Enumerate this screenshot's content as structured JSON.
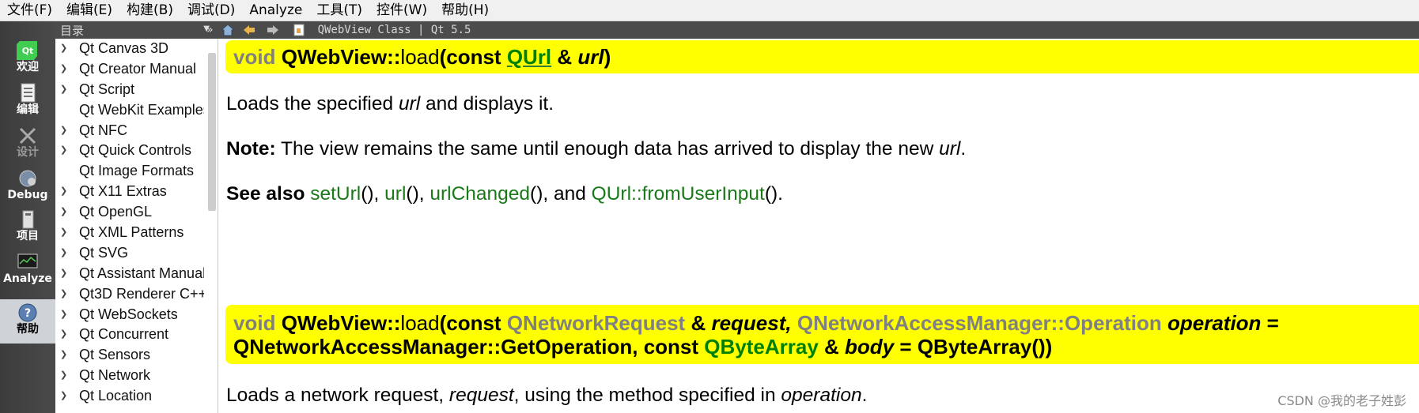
{
  "menubar": {
    "items": [
      "文件(F)",
      "编辑(E)",
      "构建(B)",
      "调试(D)",
      "Analyze",
      "工具(T)",
      "控件(W)",
      "帮助(H)"
    ]
  },
  "modes": [
    {
      "label": "欢迎",
      "icon": "qt-logo-icon"
    },
    {
      "label": "编辑",
      "icon": "edit-document-icon"
    },
    {
      "label": "设计",
      "icon": "design-tools-icon"
    },
    {
      "label": "Debug",
      "icon": "debug-bug-icon"
    },
    {
      "label": "项目",
      "icon": "project-icon"
    },
    {
      "label": "Analyze",
      "icon": "analyze-monitor-icon"
    },
    {
      "label": "帮助",
      "icon": "help-icon"
    }
  ],
  "sidebar": {
    "header": "目录",
    "items": [
      {
        "label": "Qt Canvas 3D",
        "expandable": true
      },
      {
        "label": "Qt Creator Manual",
        "expandable": true
      },
      {
        "label": "Qt Script",
        "expandable": true
      },
      {
        "label": "Qt WebKit Examples",
        "expandable": false
      },
      {
        "label": "Qt NFC",
        "expandable": true
      },
      {
        "label": "Qt Quick Controls",
        "expandable": true
      },
      {
        "label": "Qt Image Formats",
        "expandable": false
      },
      {
        "label": "Qt X11 Extras",
        "expandable": true
      },
      {
        "label": "Qt OpenGL",
        "expandable": true
      },
      {
        "label": "Qt XML Patterns",
        "expandable": true
      },
      {
        "label": "Qt SVG",
        "expandable": true
      },
      {
        "label": "Qt Assistant Manual",
        "expandable": true
      },
      {
        "label": "Qt3D Renderer C++",
        "expandable": true
      },
      {
        "label": "Qt WebSockets",
        "expandable": true
      },
      {
        "label": "Qt Concurrent",
        "expandable": true
      },
      {
        "label": "Qt Sensors",
        "expandable": true
      },
      {
        "label": "Qt Network",
        "expandable": true
      },
      {
        "label": "Qt Location",
        "expandable": true
      }
    ]
  },
  "toolbar": {
    "collapse": "»",
    "page_title": "QWebView Class | Qt 5.5"
  },
  "doc": {
    "sig1": {
      "void": "void",
      "cls": "QWebView::",
      "fn": "load",
      "open": "(const",
      "type": "QUrl",
      "amp": "&",
      "param": "url",
      "close": ")"
    },
    "p1": {
      "a": "Loads the specified ",
      "b": "url",
      "c": " and displays it."
    },
    "p2": {
      "note": "Note:",
      "a": " The view remains the same until enough data has arrived to display the new ",
      "b": "url",
      "c": "."
    },
    "p3": {
      "see": "See also",
      "l1": "setUrl",
      "s1": "(), ",
      "l2": "url",
      "s2": "(), ",
      "l3": "urlChanged",
      "s3": "(), and ",
      "l4": "QUrl::fromUserInput",
      "s4": "()."
    },
    "sig2": {
      "void": "void",
      "cls": "QWebView::",
      "fn": "load",
      "open": "(const",
      "t1": "QNetworkRequest",
      "amp1": "&",
      "p1": "request,",
      "t2": "QNetworkAccessManager::Operation",
      "p2": "operation",
      "eq": "=",
      "def": "QNetworkAccessManager::GetOperation,",
      "const2": "const",
      "t3": "QByteArray",
      "amp2": "&",
      "p3": "body",
      "eq2": "=",
      "def2": "QByteArray())"
    },
    "p4": {
      "a": "Loads a network request, ",
      "b": "request",
      "c": ", using the method specified in ",
      "d": "operation",
      "e": "."
    }
  },
  "watermark": "CSDN @我的老子姓彭"
}
